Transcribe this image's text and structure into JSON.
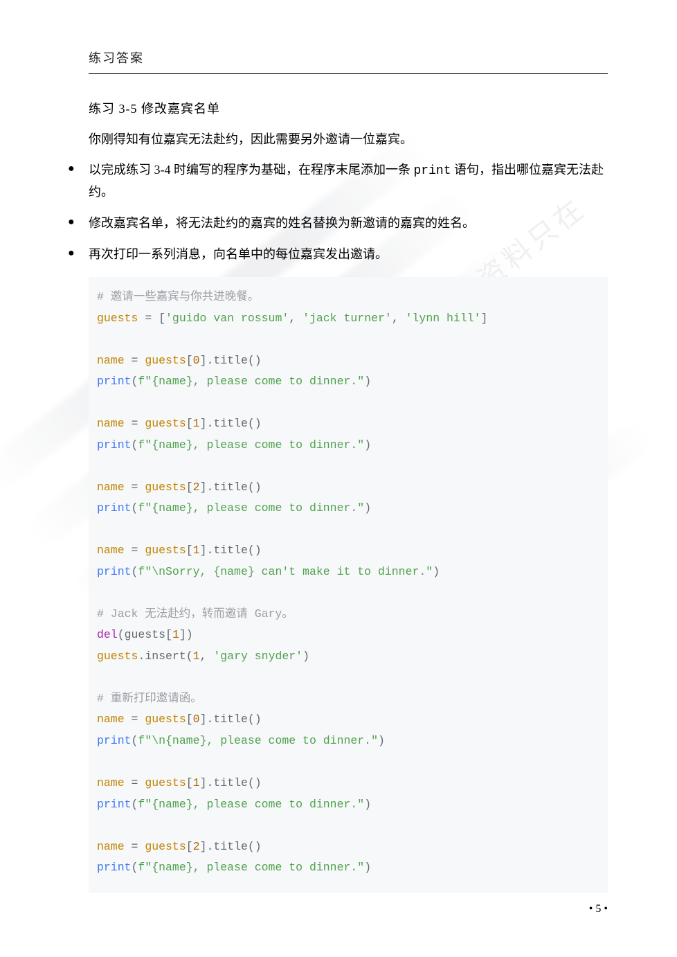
{
  "header": {
    "title": "练习答案"
  },
  "section": {
    "label_prefix": "练习 ",
    "number": "3-5",
    "title_spacer": "   ",
    "title": "修改嘉宾名单"
  },
  "intro": "你刚得知有位嘉宾无法赴约，因此需要另外邀请一位嘉宾。",
  "bullets": [
    {
      "prefix": "以完成练习 3-4 时编写的程序为基础，在程序末尾添加一条 ",
      "code": "print",
      "suffix": " 语句，指出哪位嘉宾无法赴约。"
    },
    {
      "prefix": "修改嘉宾名单，将无法赴约的嘉宾的姓名替换为新邀请的嘉宾的姓名。",
      "code": "",
      "suffix": ""
    },
    {
      "prefix": "再次打印一系列消息，向名单中的每位嘉宾发出邀请。",
      "code": "",
      "suffix": ""
    }
  ],
  "code": {
    "c1": "# 邀请一些嘉宾与你共进晚餐。",
    "l2a": "guests",
    "l2b": " = [",
    "l2c": "'guido van rossum'",
    "l2d": ", ",
    "l2e": "'jack turner'",
    "l2f": ", ",
    "l2g": "'lynn hill'",
    "l2h": "]",
    "l3a": "name",
    "l3b": " = ",
    "l3c": "guests",
    "l3d": "[",
    "l3e": "0",
    "l3f": "].title()",
    "l4a": "print",
    "l4b": "(",
    "l4c": "f\"{name}, please come to dinner.\"",
    "l4d": ")",
    "l5e": "1",
    "l6e": "2",
    "l7e": "1",
    "l8c": "f\"\\nSorry, {name} can't make it to dinner.\"",
    "c2": "# Jack 无法赴约，转而邀请 Gary。",
    "l9a": "del",
    "l9b": "(guests[",
    "l9c": "1",
    "l9d": "])",
    "l10a": "guests",
    "l10b": ".insert(",
    "l10c": "1",
    "l10d": ", ",
    "l10e": "'gary snyder'",
    "l10f": ")",
    "c3": "# 重新打印邀请函。",
    "l11c": "f\"\\n{name}, please come to dinner.\""
  },
  "page_num": "• 5 •",
  "watermark_text": "更多免费课后习题答案资料只在"
}
